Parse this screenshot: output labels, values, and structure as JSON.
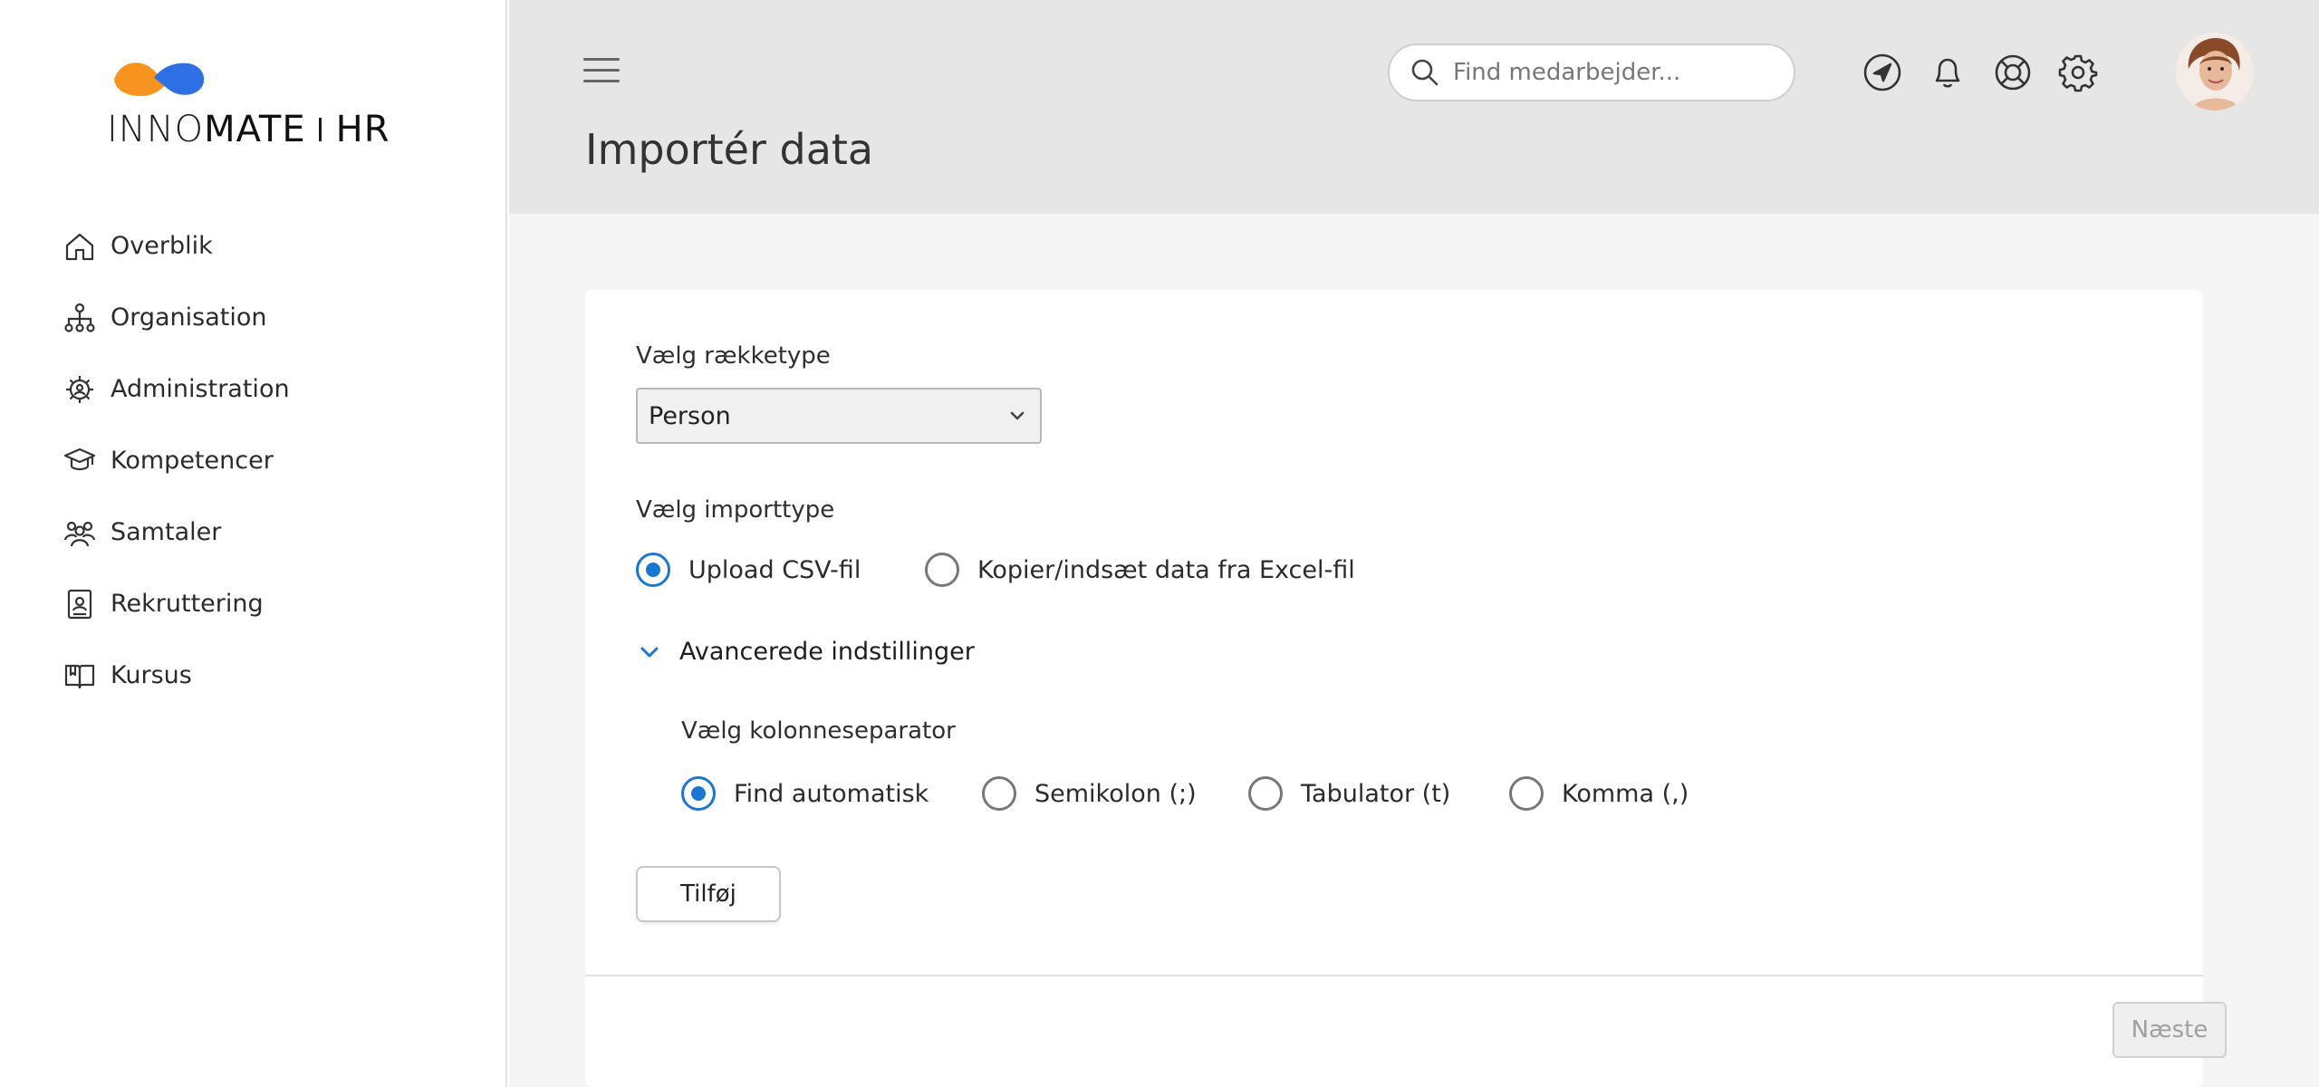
{
  "brand": {
    "name_part1": "INNO",
    "name_part2": "MATE",
    "name_part3": "HR",
    "colors": {
      "orange": "#f7931e",
      "blue": "#2f6fe4"
    }
  },
  "sidebar": {
    "items": [
      {
        "label": "Overblik",
        "icon": "home-icon"
      },
      {
        "label": "Organisation",
        "icon": "org-chart-icon"
      },
      {
        "label": "Administration",
        "icon": "gear-user-icon"
      },
      {
        "label": "Kompetencer",
        "icon": "graduation-cap-icon"
      },
      {
        "label": "Samtaler",
        "icon": "people-icon"
      },
      {
        "label": "Rekruttering",
        "icon": "id-card-icon"
      },
      {
        "label": "Kursus",
        "icon": "book-icon"
      }
    ]
  },
  "header": {
    "title": "Importér data",
    "search_placeholder": "Find medarbejder...",
    "icons": [
      "navigation-icon",
      "bell-icon",
      "lifebuoy-icon",
      "settings-icon"
    ]
  },
  "form": {
    "row_type_label": "Vælg rækketype",
    "row_type_value": "Person",
    "import_type_label": "Vælg importtype",
    "import_options": [
      {
        "label": "Upload CSV-fil",
        "checked": true
      },
      {
        "label": "Kopier/indsæt data fra Excel-fil",
        "checked": false
      }
    ],
    "advanced_label": "Avancerede indstillinger",
    "separator_label": "Vælg kolonneseparator",
    "separator_options": [
      {
        "label": "Find automatisk",
        "checked": true
      },
      {
        "label": "Semikolon (;)",
        "checked": false
      },
      {
        "label": "Tabulator (t)",
        "checked": false
      },
      {
        "label": "Komma (,)",
        "checked": false
      }
    ],
    "add_button": "Tilføj",
    "next_button": "Næste"
  },
  "colors": {
    "accent": "#1976d2",
    "header_bg": "#e6e6e6"
  }
}
